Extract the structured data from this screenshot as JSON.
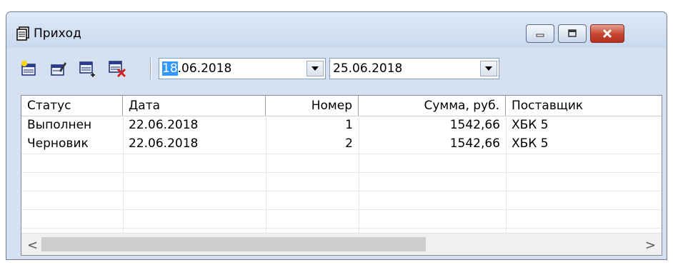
{
  "window": {
    "title": "Приход"
  },
  "toolbar": {
    "buttons": [
      {
        "name": "new-document-icon"
      },
      {
        "name": "edit-document-icon"
      },
      {
        "name": "add-row-icon"
      },
      {
        "name": "delete-row-icon"
      }
    ],
    "date_from": {
      "selected_part": "18",
      "rest": ".06.2018"
    },
    "date_to": {
      "value": "25.06.2018"
    }
  },
  "grid": {
    "columns": [
      "Статус",
      "Дата",
      "Номер",
      "Сумма, руб.",
      "Поставщик"
    ],
    "rows": [
      [
        "Выполнен",
        "22.06.2018",
        "1",
        "1542,66",
        "ХБК 5"
      ],
      [
        "Черновик",
        "22.06.2018",
        "2",
        "1542,66",
        "ХБК 5"
      ]
    ]
  },
  "scrollbar": {
    "left_arrow": "<",
    "right_arrow": ">"
  }
}
